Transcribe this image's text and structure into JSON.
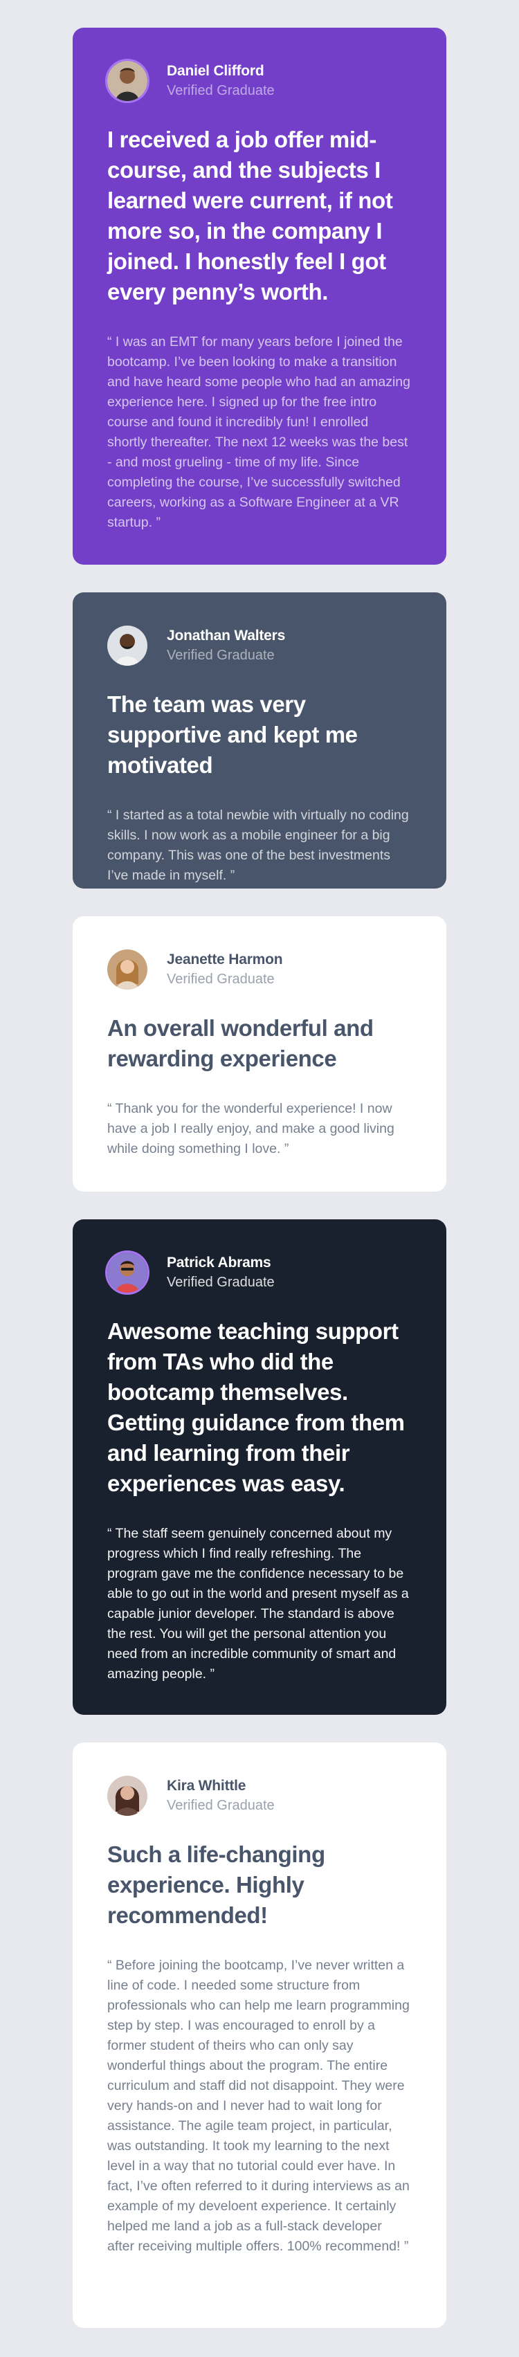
{
  "testimonials": [
    {
      "name": "Daniel Clifford",
      "role": "Verified Graduate",
      "headline": "I received a job offer mid-course, and the subjects I learned were current, if not more so, in the company I joined. I honestly feel I got every penny’s worth.",
      "quote": "“ I was an EMT for many years before I joined the bootcamp. I’ve been looking to make a transition and have heard some people who had an amazing experience here. I signed up for the free intro course and found it incredibly fun! I enrolled shortly thereafter. The next 12 weeks was the best - and most grueling - time of my life. Since completing the course, I’ve successfully switched careers, working as a Software Engineer at a VR startup. ”",
      "card_color": "#733fc8",
      "avatar_icon": "avatar-daniel"
    },
    {
      "name": "Jonathan Walters",
      "role": "Verified Graduate",
      "headline": "The team was very supportive and kept me motivated",
      "quote": "“ I started as a total newbie with virtually no coding skills. I now work as a mobile engineer for a big company. This was one of the best investments I’ve made in myself. ”",
      "card_color": "#48556a",
      "avatar_icon": "avatar-jonathan"
    },
    {
      "name": "Jeanette Harmon",
      "role": "Verified Graduate",
      "headline": "An overall wonderful and rewarding experience",
      "quote": "“ Thank you for the wonderful experience! I now have a job I really enjoy, and make a good living while doing something I love. ”",
      "card_color": "#ffffff",
      "avatar_icon": "avatar-jeanette"
    },
    {
      "name": "Patrick Abrams",
      "role": "Verified Graduate",
      "headline": "Awesome teaching support from TAs who did the bootcamp themselves. Getting guidance from them and learning from their experiences was easy.",
      "quote": "“ The staff seem genuinely concerned about my progress which I find really refreshing. The program gave me the confidence necessary to be able to go out in the world and present myself as a capable junior developer. The standard is above the rest. You will get the personal attention you need from an incredible community of smart and amazing people. ”",
      "card_color": "#19212e",
      "avatar_icon": "avatar-patrick"
    },
    {
      "name": "Kira Whittle",
      "role": "Verified Graduate",
      "headline": "Such a life-changing experience. Highly recommended!",
      "quote": "“ Before joining the bootcamp, I’ve never written a line of code. I needed some structure from professionals who can help me learn programming step by step. I was encouraged to enroll by a former student of theirs who can only say wonderful things about the program. The entire curriculum and staff did not disappoint. They were very hands-on and I never had to wait long for assistance. The agile team project, in particular, was outstanding. It took my learning to the next level in a way that no tutorial could ever have. In fact, I’ve often referred to it during interviews as an example of my develoent experience. It certainly helped me land a job as a full-stack developer after receiving multiple offers. 100% recommend! ”",
      "card_color": "#ffffff",
      "avatar_icon": "avatar-kira"
    }
  ]
}
